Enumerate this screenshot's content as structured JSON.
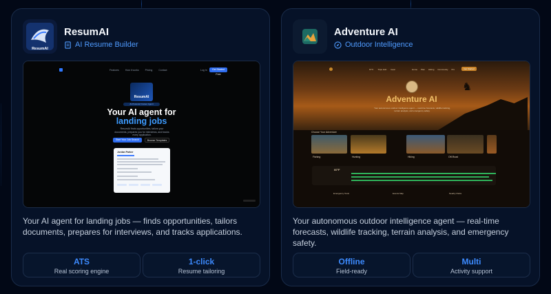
{
  "cards": [
    {
      "name": "ResumAI",
      "tag": "AI Resume Builder",
      "logo_text": "ResumAI",
      "description": "Your AI agent for landing jobs — finds opportunities, tailors documents, prepares for interviews, and tracks applications.",
      "stats": [
        {
          "value": "ATS",
          "label": "Real scoring engine"
        },
        {
          "value": "1-click",
          "label": "Resume tailoring"
        }
      ],
      "preview": {
        "nav_links": [
          "Features",
          "How it works",
          "Pricing",
          "Contact"
        ],
        "login": "Log In",
        "cta": "Get Started Free",
        "logo_text": "ResumAI",
        "pill": "AI-Powered Career Agent",
        "headline_1": "Your AI agent for",
        "headline_2": "landing jobs",
        "subtext": "ResumAI finds opportunities, tailors your documents, prepares you for interviews, and tracks every application.",
        "primary_button": "Start Your Job Search",
        "secondary_button": "Browse Templates",
        "resume_name": "Jordan Parker"
      }
    },
    {
      "name": "Adventure AI",
      "tag": "Outdoor Intelligence",
      "description": "Your autonomous outdoor intelligence agent — real-time forecasts, wildlife tracking, terrain analysis, and emergency safety.",
      "stats": [
        {
          "value": "Offline",
          "label": "Field-ready"
        },
        {
          "value": "Multi",
          "label": "Activity support"
        }
      ],
      "preview": {
        "nav_links": [
          "67°F",
          "Trips Hub",
          "Gear"
        ],
        "nav_links_2": [
          "Home",
          "Plan",
          "Hiking",
          "Community",
          "Pro"
        ],
        "cta": "Get Started",
        "title": "Adventure AI",
        "subtext": "Your autonomous outdoor intelligence agent — real-time forecasts, wildlife tracking, terrain analysis, and emergency safety.",
        "section": "Choose Your Adventure",
        "tiles": [
          "Fishing",
          "Hunting",
          "Hiking",
          "Off-Road"
        ],
        "temp": "60°F",
        "bottom": [
          "Emergency Tools",
          "Events Map",
          "Nearby Parks"
        ]
      }
    }
  ],
  "colors": {
    "accent": "#3d8bff",
    "background": "#020816",
    "card": "#061228"
  }
}
